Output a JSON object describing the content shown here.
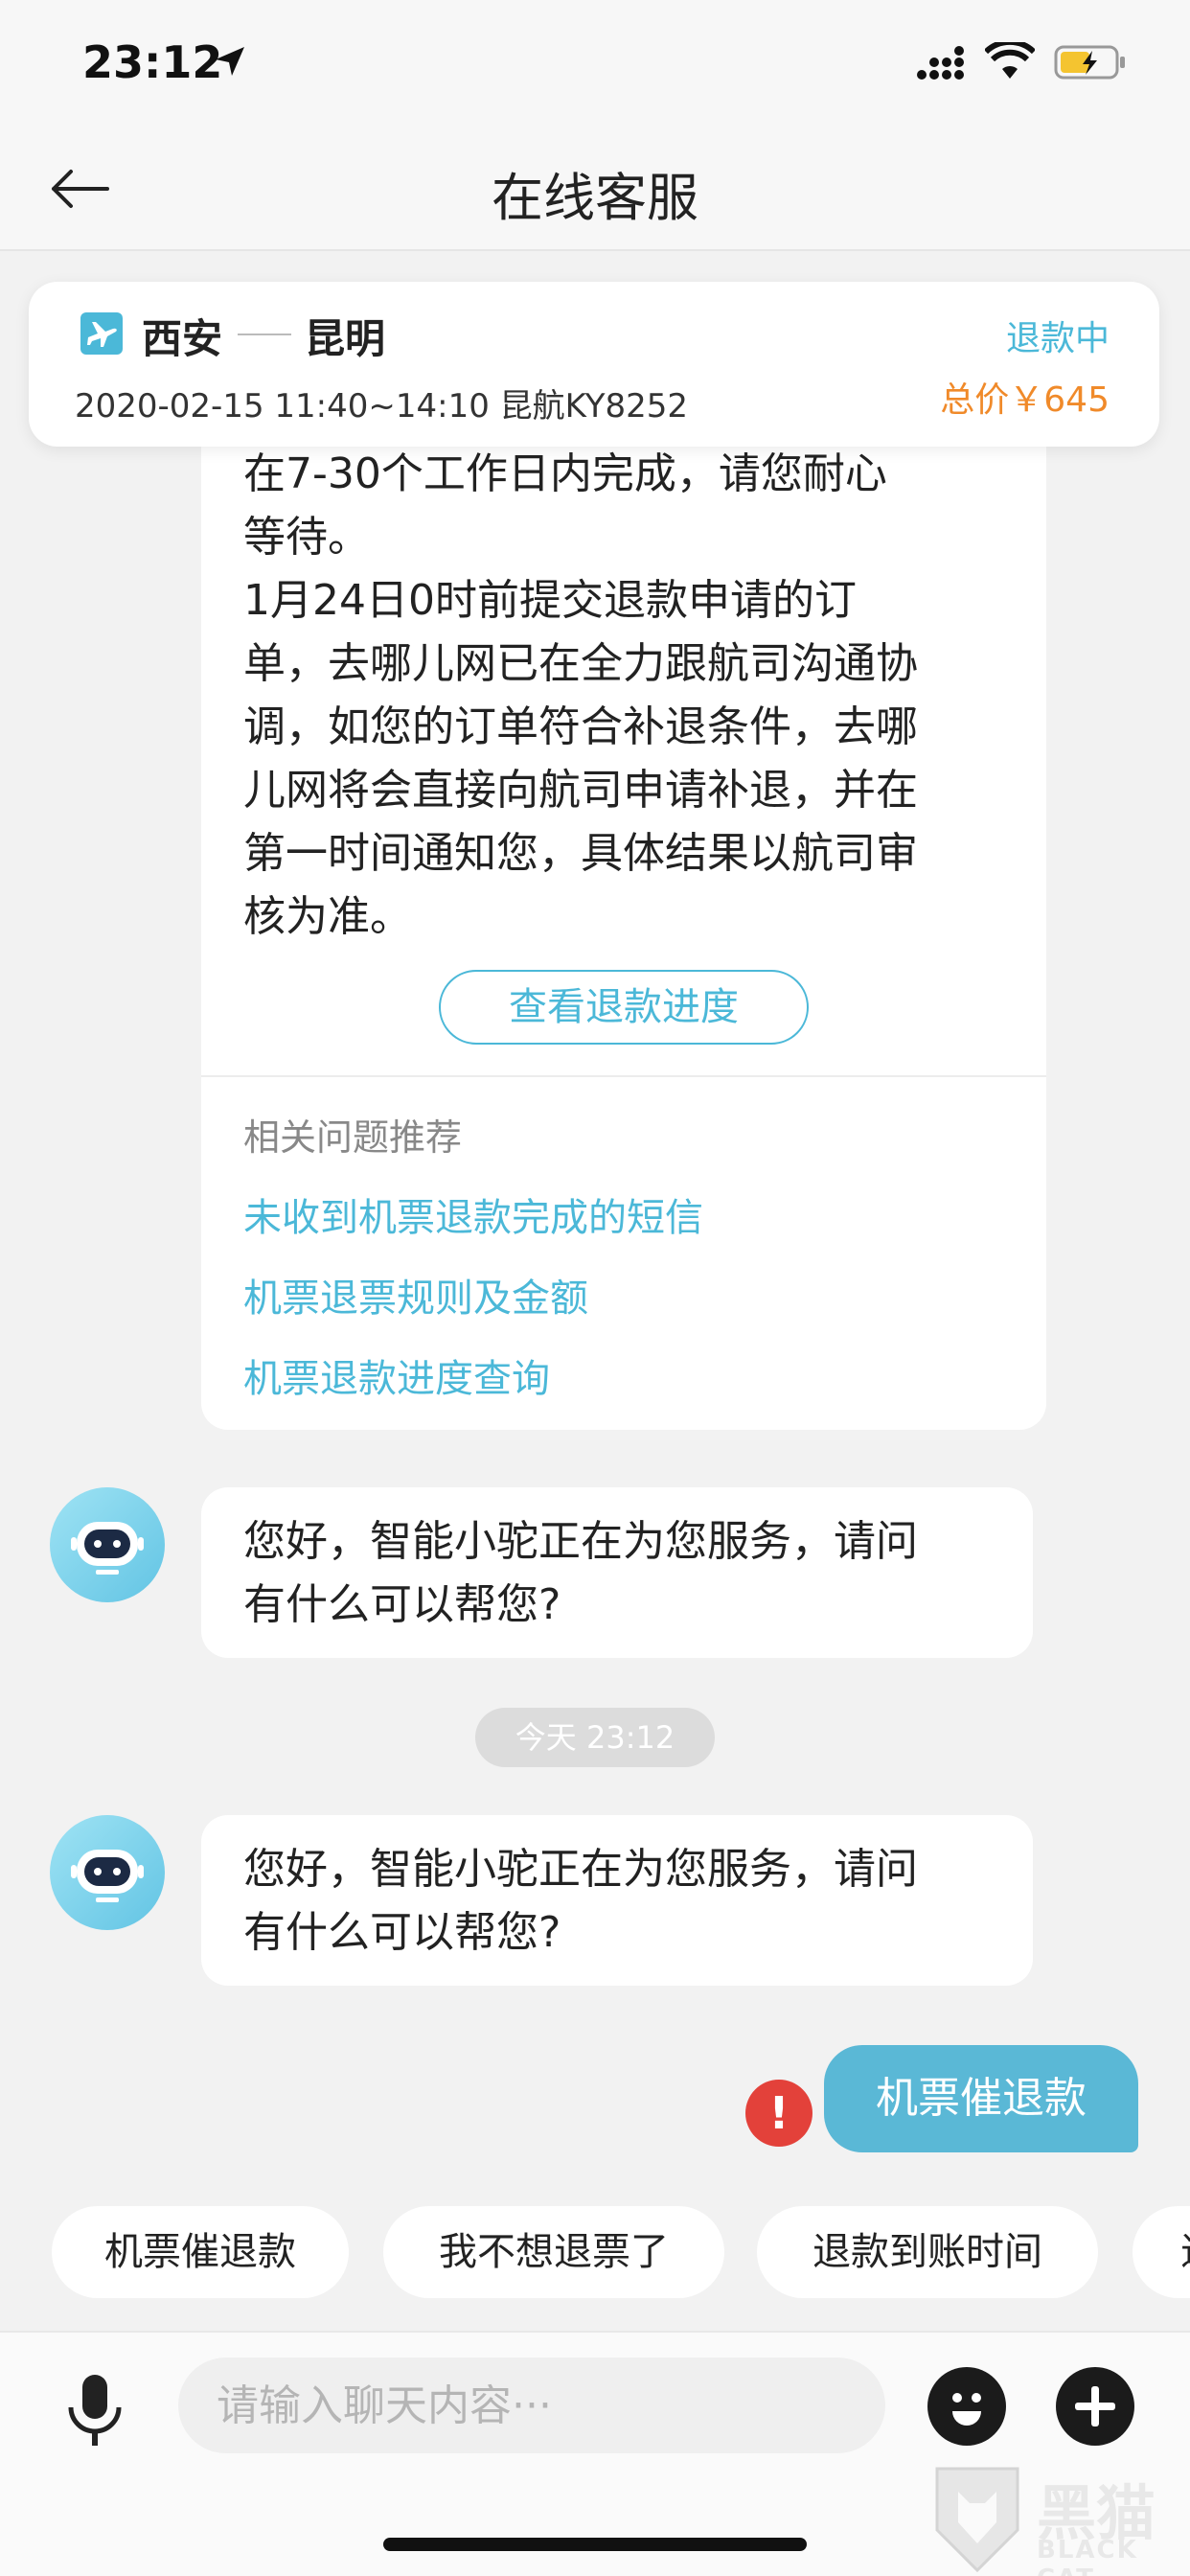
{
  "status_bar": {
    "time": "23:12"
  },
  "nav": {
    "title": "在线客服"
  },
  "flight": {
    "from": "西安",
    "to": "昆明",
    "info": "2020-02-15 11:40~14:10   昆航KY8252",
    "status": "退款中",
    "price": "总价￥645"
  },
  "answer_card": {
    "text": "在7-30个工作日内完成，请您耐心\n等待。\n1月24日0时前提交退款申请的订\n单，去哪儿网已在全力跟航司沟通协\n调，如您的订单符合补退条件，去哪\n儿网将会直接向航司申请补退，并在\n第一时间通知您，具体结果以航司审\n核为准。",
    "progress_button": "查看退款进度",
    "related_title": "相关问题推荐",
    "related_links": [
      "未收到机票退款完成的短信",
      "机票退票规则及金额",
      "机票退款进度查询"
    ]
  },
  "messages": [
    {
      "sender": "bot",
      "text": "您好，智能小驼正在为您服务，请问\n有什么可以帮您?"
    },
    {
      "sender": "bot",
      "text": "您好，智能小驼正在为您服务，请问\n有什么可以帮您?"
    },
    {
      "sender": "user",
      "text": "机票催退款",
      "failed": true
    }
  ],
  "timestamp": "今天 23:12",
  "quick_replies": [
    "机票催退款",
    "我不想退票了",
    "退款到账时间",
    "退"
  ],
  "input": {
    "placeholder": "请输入聊天内容···"
  },
  "watermark": {
    "cn": "黑猫",
    "en": "BLACK CAT"
  },
  "colors": {
    "accent": "#4bb8d8",
    "price": "#f08a2a",
    "error": "#e3413a",
    "user_bubble": "#5ab8d6"
  }
}
